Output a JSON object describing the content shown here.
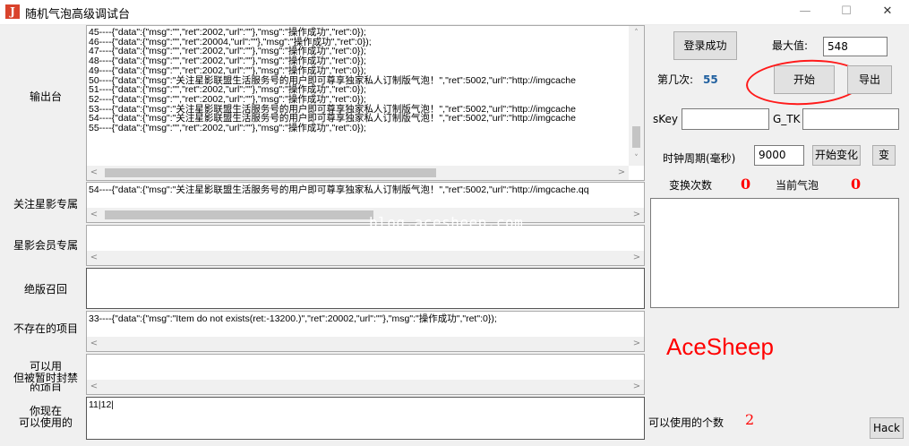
{
  "window": {
    "title": "随机气泡高级调试台",
    "app_icon_glyph": "J",
    "minimize_glyph": "—",
    "maximize_glyph": "☐",
    "close_glyph": "✕"
  },
  "labels": {
    "output": "输出台",
    "follow": "关注星影专属",
    "member": "星影会员专属",
    "outofprint": "绝版召回",
    "notexist": "不存在的项目",
    "banned_line1": "可以用",
    "banned_line2": "但被暂时封禁",
    "banned_line3": "的项目",
    "usable_line1": "你现在",
    "usable_line2": "可以使用的"
  },
  "output_log": [
    "45----{\"data\":{\"msg\":\"\",\"ret\":2002,\"url\":\"\"},\"msg\":\"操作成功\",\"ret\":0});",
    "46----{\"data\":{\"msg\":\"\",\"ret\":20004,\"url\":\"\"},\"msg\":\"操作成功\",\"ret\":0});",
    "47----{\"data\":{\"msg\":\"\",\"ret\":2002,\"url\":\"\"},\"msg\":\"操作成功\",\"ret\":0});",
    "48----{\"data\":{\"msg\":\"\",\"ret\":2002,\"url\":\"\"},\"msg\":\"操作成功\",\"ret\":0});",
    "49----{\"data\":{\"msg\":\"\",\"ret\":2002,\"url\":\"\"},\"msg\":\"操作成功\",\"ret\":0});",
    "50----{\"data\":{\"msg\":\"关注星影联盟生活服务号的用户即可尊享独家私人订制版气泡！\",\"ret\":5002,\"url\":\"http://imgcache",
    "51----{\"data\":{\"msg\":\"\",\"ret\":2002,\"url\":\"\"},\"msg\":\"操作成功\",\"ret\":0});",
    "52----{\"data\":{\"msg\":\"\",\"ret\":2002,\"url\":\"\"},\"msg\":\"操作成功\",\"ret\":0});",
    "53----{\"data\":{\"msg\":\"关注星影联盟生活服务号的用户即可尊享独家私人订制版气泡！\",\"ret\":5002,\"url\":\"http://imgcache",
    "54----{\"data\":{\"msg\":\"关注星影联盟生活服务号的用户即可尊享独家私人订制版气泡！\",\"ret\":5002,\"url\":\"http://imgcache",
    "55----{\"data\":{\"msg\":\"\",\"ret\":2002,\"url\":\"\"},\"msg\":\"操作成功\",\"ret\":0});"
  ],
  "follow_log": "54----{\"data\":{\"msg\":\"关注星影联盟生活服务号的用户即可尊享独家私人订制版气泡！\",\"ret\":5002,\"url\":\"http://imgcache.qq",
  "member_log": "",
  "outofprint_log": "",
  "notexist_log": "33----{\"data\":{\"msg\":\"Item do not exists(ret:-13200.)\",\"ret\":20002,\"url\":\"\"},\"msg\":\"操作成功\",\"ret\":0});",
  "banned_log": "",
  "usable_log": "11|12|",
  "scroll_glyphs": {
    "left": "<",
    "right": ">",
    "up": "˄",
    "down": "˅"
  },
  "right_panel": {
    "login_button": "登录成功",
    "max_label": "最大值:",
    "max_value": "548",
    "count_label": "第几次:",
    "count_value": "55",
    "start_button": "开始",
    "export_button": "导出",
    "skey_label": "sKey",
    "skey_value": "",
    "gtk_label": "G_TK",
    "gtk_value": "",
    "clock_label": "时钟周期(毫秒)",
    "clock_value": "9000",
    "start_change_button": "开始变化",
    "change_button": "变",
    "swap_count_label": "变换次数",
    "swap_count_value": "0",
    "current_bubble_label": "当前气泡",
    "current_bubble_value": "0",
    "usable_count_label": "可以使用的个数",
    "usable_count_value": "2",
    "hack_button": "Hack"
  },
  "overlay": {
    "watermark": "blog.acesheep.com",
    "brand": "AceSheep"
  },
  "colors": {
    "count_value": "#1f5f9f",
    "red_values": "#ff0000",
    "annotation_circle": "#ff1a1a"
  }
}
